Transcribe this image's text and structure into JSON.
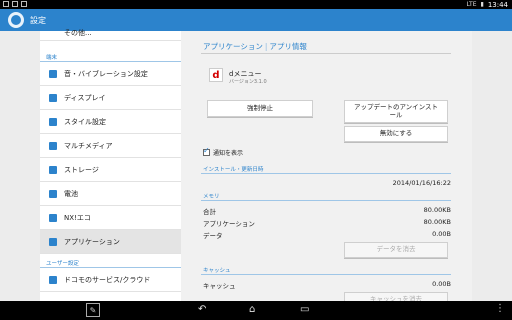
{
  "statusbar": {
    "time": "13:44",
    "signal": "LTE"
  },
  "actionbar": {
    "title": "設定"
  },
  "sidebar": {
    "partial_item": "その他...",
    "section_device": "端末",
    "items": [
      {
        "label": "音・バイブレーション設定"
      },
      {
        "label": "ディスプレイ"
      },
      {
        "label": "スタイル設定"
      },
      {
        "label": "マルチメディア"
      },
      {
        "label": "ストレージ"
      },
      {
        "label": "電池"
      },
      {
        "label": "NX!エコ"
      },
      {
        "label": "アプリケーション"
      }
    ],
    "section_user": "ユーザー設定",
    "user_items": [
      {
        "label": "ドコモのサービス/クラウド"
      }
    ]
  },
  "detail": {
    "breadcrumb_1": "アプリケーション",
    "breadcrumb_sep": "|",
    "breadcrumb_2": "アプリ情報",
    "app_icon": "d",
    "app_name": "dメニュー",
    "app_version": "バージョン3.1.0",
    "force_stop": "強制停止",
    "uninstall_updates": "アップデートのアンインストール",
    "disable": "無効にする",
    "show_notifications": "通知を表示",
    "section_install": "インストール・更新日時",
    "install_date": "2014/01/16/16:22",
    "section_memory": "メモリ",
    "memory_rows": [
      {
        "label": "合計",
        "value": "80.00KB"
      },
      {
        "label": "アプリケーション",
        "value": "80.00KB"
      },
      {
        "label": "データ",
        "value": "0.00B"
      }
    ],
    "clear_data": "データを消去",
    "section_cache": "キャッシュ",
    "cache_label": "キャッシュ",
    "cache_value": "0.00B",
    "clear_cache": "キャッシュを消去"
  },
  "navbar": {
    "pen": "✎",
    "back": "↶",
    "home": "⌂",
    "recents": "▭",
    "menu": "⋮"
  }
}
